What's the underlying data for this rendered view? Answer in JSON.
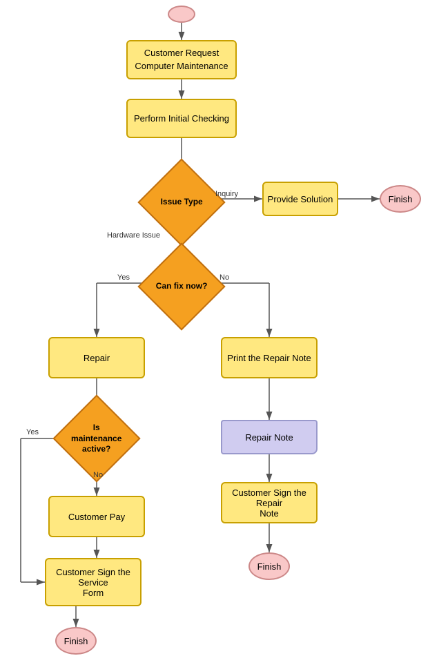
{
  "nodes": {
    "start": {
      "label": ""
    },
    "customer_request": {
      "label": "Customer Request\nComputer Maintenance"
    },
    "initial_checking": {
      "label": "Perform Initial Checking"
    },
    "issue_type": {
      "label": "Issue Type"
    },
    "provide_solution": {
      "label": "Provide Solution"
    },
    "finish_top": {
      "label": "Finish"
    },
    "can_fix": {
      "label": "Can fix now?"
    },
    "repair": {
      "label": "Repair"
    },
    "print_repair_note": {
      "label": "Print the Repair Note"
    },
    "is_maintenance": {
      "label": "Is\nmaintenance\nactive?"
    },
    "repair_note": {
      "label": "Repair Note"
    },
    "customer_pay": {
      "label": "Customer Pay"
    },
    "customer_sign_repair": {
      "label": "Customer Sign the Repair\nNote"
    },
    "customer_sign_service": {
      "label": "Customer Sign the Service\nForm"
    },
    "finish_right": {
      "label": "Finish"
    },
    "finish_bottom": {
      "label": "Finish"
    }
  },
  "labels": {
    "inquiry": "Inquiry",
    "hardware_issue": "Hardware Issue",
    "yes_fix": "Yes",
    "no_fix": "No",
    "yes_maint": "Yes",
    "no_maint": "No"
  }
}
